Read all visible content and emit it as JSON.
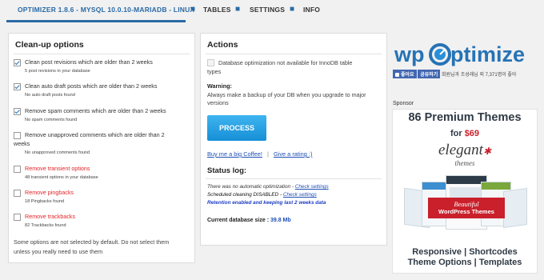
{
  "tabs": [
    {
      "label": "OPTIMIZER 1.8.6 - MYSQL 10.0.10-MARIADB - LINUX"
    },
    {
      "label": "TABLES"
    },
    {
      "label": "SETTINGS"
    },
    {
      "label": "INFO"
    }
  ],
  "tab_separator": "■",
  "cleanup": {
    "title": "Clean-up options",
    "options": [
      {
        "label": "Clean post revisions which are older than 2 weeks",
        "sub": "5 post revisions in your database",
        "checked": true,
        "warning": false
      },
      {
        "label": "Clean auto draft posts which are older than 2 weeks",
        "sub": "No auto draft posts found",
        "checked": true,
        "warning": false
      },
      {
        "label": "Remove spam comments which are older than 2 weeks",
        "sub": "No spam comments found",
        "checked": true,
        "warning": false
      },
      {
        "label": "Remove unapproved comments which are older than 2",
        "label2": "weeks",
        "sub": "No unapproved comments found",
        "checked": false,
        "warning": false
      },
      {
        "label": "Remove transient options",
        "sub": "48 transient options in your database",
        "checked": false,
        "warning": true
      },
      {
        "label": "Remove pingbacks",
        "sub": "18 Pingbacks found",
        "checked": false,
        "warning": true
      },
      {
        "label": "Remove trackbacks",
        "sub": "82 Trackbacks found",
        "checked": false,
        "warning": true
      }
    ],
    "note_line1": "Some options are not selected by default. Do not select them",
    "note_line2": "unless you really need to use them"
  },
  "actions": {
    "title": "Actions",
    "innodb_line1": "Database optimization not available for InnoDB table",
    "innodb_line2": "types",
    "warning_label": "Warning:",
    "warning_line1": "Always make a backup of your DB when you upgrade to major",
    "warning_line2": "versions",
    "process_label": "PROCESS",
    "coffee_link": "Buy me a big Coffee!",
    "link_sep": "|",
    "rating_link": "Give a rating :)",
    "status_title": "Status log:",
    "log": {
      "line1_text": "There was no automatic optimization - ",
      "line1_link": "Check settings",
      "line2_text": "Scheduled cleaning DISABLED - ",
      "line2_link": "Check settings",
      "line3": "Retention enabled and keeping last 2 weeks data"
    },
    "db_size_label": "Current database size : ",
    "db_size_value": "39.8 Mb"
  },
  "sidebar": {
    "logo_left": "wp",
    "logo_right": "ptimize",
    "like_button": "좋아요",
    "share_button": "공유하기",
    "like_text": "회원님과 조성래님 외 7,371명이 좋아",
    "sponsor_label": "Sponsor",
    "ad": {
      "headline": "86 Premium Themes",
      "price_prefix": "for ",
      "price": "$69",
      "brand": "elegant",
      "brand_sub": "themes",
      "ribbon1": "Beautiful",
      "ribbon2": "WordPress Themes",
      "footer1": "Responsive | Shortcodes",
      "footer2": "Theme Options | Templates"
    }
  },
  "colors": {
    "accent": "#2a6aa6",
    "process_button": "#1ea2e8",
    "warning_red": "#e0262a",
    "link_blue": "#1e4fb4",
    "ad_blue": "#2673b5",
    "ad_red": "#c9202c"
  }
}
